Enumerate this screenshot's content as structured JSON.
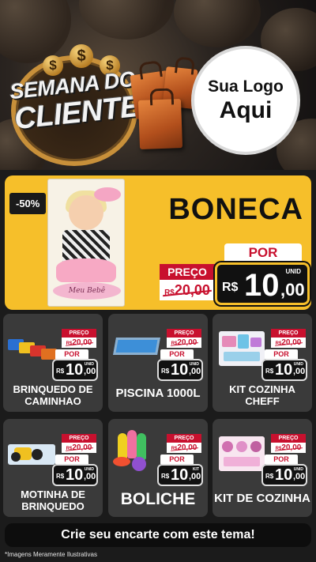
{
  "header": {
    "campaign_line1": "SEMANA DO",
    "campaign_line2": "CLIENTE",
    "logo_line1": "Sua Logo",
    "logo_line2": "Aqui"
  },
  "featured": {
    "discount": "-50%",
    "name": "BONECA",
    "box_label": "Meu Bebê",
    "preco_label": "PREÇO",
    "old_price_prefix": "R$",
    "old_price": "20,00",
    "por_label": "POR",
    "currency": "R$",
    "price_int": "10",
    "price_dec": ",00",
    "unit": "UNID"
  },
  "products": [
    {
      "name": "BRINQUEDO DE CAMINHAO",
      "preco_label": "PREÇO",
      "old_prefix": "R$",
      "old_price": "20,00",
      "por_label": "POR",
      "currency": "R$",
      "price_int": "10",
      "price_dec": ",00",
      "unit": "UNID"
    },
    {
      "name": "PISCINA 1000L",
      "preco_label": "PREÇO",
      "old_prefix": "R$",
      "old_price": "20,00",
      "por_label": "POR",
      "currency": "R$",
      "price_int": "10",
      "price_dec": ",00",
      "unit": "UNID"
    },
    {
      "name": "KIT COZINHA CHEFF",
      "preco_label": "PREÇO",
      "old_prefix": "R$",
      "old_price": "20,00",
      "por_label": "POR",
      "currency": "R$",
      "price_int": "10",
      "price_dec": ",00",
      "unit": "UNID"
    },
    {
      "name": "MOTINHA DE BRINQUEDO",
      "preco_label": "PREÇO",
      "old_prefix": "R$",
      "old_price": "20,00",
      "por_label": "POR",
      "currency": "R$",
      "price_int": "10",
      "price_dec": ",00",
      "unit": "UNID"
    },
    {
      "name": "BOLICHE",
      "preco_label": "PREÇO",
      "old_prefix": "R$",
      "old_price": "20,00",
      "por_label": "POR",
      "currency": "R$",
      "price_int": "10",
      "price_dec": ",00",
      "unit": "KIT"
    },
    {
      "name": "KIT DE COZINHA",
      "preco_label": "PREÇO",
      "old_prefix": "R$",
      "old_price": "20,00",
      "por_label": "POR",
      "currency": "R$",
      "price_int": "10",
      "price_dec": ",00",
      "unit": "UNID"
    }
  ],
  "cta": "Crie seu encarte com este tema!",
  "footer_note": "*Imagens Meramente Ilustrativas",
  "colors": {
    "background": "#1b1b1b",
    "featured_bg": "#f6bf2a",
    "card_bg": "#3a3a3a",
    "accent_red": "#c8102e",
    "price_tag_bg": "#111111"
  }
}
